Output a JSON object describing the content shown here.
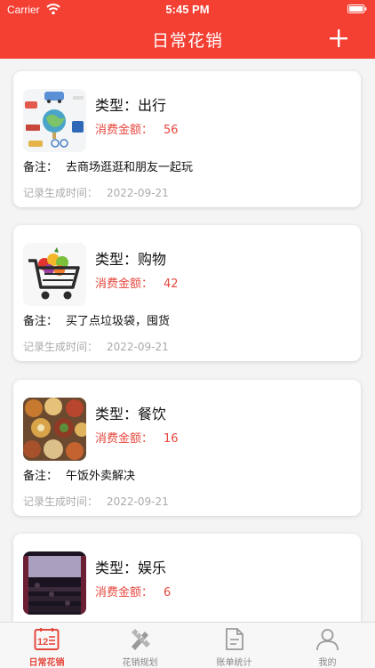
{
  "status_bar": {
    "carrier": "Carrier",
    "time": "5:45 PM"
  },
  "nav": {
    "title": "日常花销",
    "add_icon": "plus-icon"
  },
  "labels": {
    "type": "类型：",
    "amount": "消费金额：",
    "note": "备注：",
    "time": "记录生成时间："
  },
  "records": [
    {
      "type": "出行",
      "amount": "56",
      "note": "去商场逛逛和朋友一起玩",
      "time": "2022-09-21",
      "image": "travel-image"
    },
    {
      "type": "购物",
      "amount": "42",
      "note": "买了点垃圾袋，囤货",
      "time": "2022-09-21",
      "image": "shopping-cart-image"
    },
    {
      "type": "餐饮",
      "amount": "16",
      "note": "午饭外卖解决",
      "time": "2022-09-21",
      "image": "food-image"
    },
    {
      "type": "娱乐",
      "amount": "6",
      "note": "",
      "time": "",
      "image": "cinema-image"
    }
  ],
  "tabs": [
    {
      "label": "日常花销",
      "icon": "calendar-icon",
      "active": true
    },
    {
      "label": "花销规划",
      "icon": "ruler-pencil-icon",
      "active": false
    },
    {
      "label": "账单统计",
      "icon": "document-icon",
      "active": false
    },
    {
      "label": "我的",
      "icon": "person-icon",
      "active": false
    }
  ],
  "colors": {
    "accent": "#f43f33",
    "amount": "#e6473d",
    "muted": "#aaaaaa",
    "tab_inactive": "#888888"
  }
}
